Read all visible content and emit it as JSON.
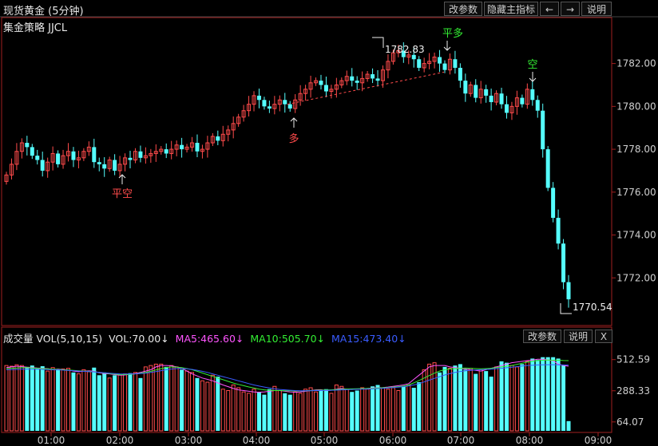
{
  "header": {
    "title": "现货黄金 (5分钟)",
    "strategy": "集金策略 JJCL",
    "buttons": {
      "params": "改参数",
      "hide_indicator": "隐藏主指标",
      "left": "←",
      "right": "→",
      "help": "说明"
    }
  },
  "volume_panel": {
    "label": "成交量 VOL(5,10,15)",
    "vol": "VOL:70.00↓",
    "ma5": "MA5:465.60↓",
    "ma10": "MA10:505.70↓",
    "ma15": "MA15:473.40↓",
    "buttons": {
      "params": "改参数",
      "help": "说明",
      "close": "X"
    }
  },
  "annotations": {
    "flat_short": "平空",
    "long": "多",
    "flat_long": "平多",
    "short": "空",
    "high_value": "1782.83",
    "low_value": "1770.54"
  },
  "colors": {
    "up": "#ff4b4b",
    "down": "#55ffff",
    "ma5": "#ff55ff",
    "ma10": "#33ee33",
    "ma15": "#3a5cff",
    "axis": "#a02020"
  },
  "chart_data": [
    {
      "type": "candlestick",
      "title": "现货黄金 (5分钟)",
      "y_ticks": [
        1782.0,
        1780.0,
        1778.0,
        1776.0,
        1774.0,
        1772.0
      ],
      "ylim": [
        1770.0,
        1783.4
      ],
      "x_ticks": [
        "01:00",
        "02:00",
        "03:00",
        "04:00",
        "05:00",
        "06:00",
        "07:00",
        "08:00",
        "09:00"
      ],
      "close_series": [
        1776.8,
        1777.3,
        1777.9,
        1778.3,
        1778.1,
        1777.7,
        1777.5,
        1777.0,
        1777.4,
        1777.8,
        1777.3,
        1777.7,
        1777.9,
        1777.5,
        1777.6,
        1777.9,
        1778.1,
        1777.4,
        1777.3,
        1777.1,
        1777.5,
        1777.0,
        1777.3,
        1777.6,
        1777.5,
        1777.9,
        1777.6,
        1777.7,
        1777.8,
        1777.9,
        1778.0,
        1777.8,
        1778.0,
        1778.2,
        1778.0,
        1778.1,
        1778.3,
        1777.9,
        1778.0,
        1778.3,
        1778.6,
        1778.4,
        1778.7,
        1778.9,
        1779.2,
        1779.5,
        1779.8,
        1780.1,
        1780.5,
        1780.3,
        1780.0,
        1779.9,
        1780.1,
        1780.3,
        1780.1,
        1779.9,
        1780.3,
        1780.6,
        1780.8,
        1781.1,
        1781.2,
        1781.0,
        1780.7,
        1780.8,
        1781.0,
        1781.2,
        1781.4,
        1781.2,
        1781.1,
        1781.3,
        1781.5,
        1781.3,
        1781.2,
        1781.7,
        1782.1,
        1782.5,
        1782.6,
        1782.3,
        1782.4,
        1782.2,
        1781.8,
        1782.0,
        1782.1,
        1782.3,
        1782.0,
        1781.7,
        1782.2,
        1781.8,
        1781.2,
        1780.6,
        1781.0,
        1780.4,
        1780.8,
        1780.5,
        1780.2,
        1780.6,
        1780.1,
        1779.7,
        1780.0,
        1780.4,
        1780.1,
        1780.8,
        1780.3,
        1779.8,
        1778.0,
        1776.2,
        1774.8,
        1773.6,
        1771.8,
        1771.0
      ],
      "annotations": [
        {
          "label": "平空",
          "x": "02:00",
          "y": 1776.8
        },
        {
          "label": "多",
          "x": "05:30",
          "y": 1779.4
        },
        {
          "label": "平多",
          "x": "08:00",
          "y": 1782.1
        },
        {
          "label": "空",
          "x": "09:00",
          "y": 1780.9
        },
        {
          "label": "1782.83",
          "x": "06:55",
          "y": 1782.83
        },
        {
          "label": "1770.54",
          "x": "09:35",
          "y": 1770.54
        }
      ]
    },
    {
      "type": "bar",
      "title": "成交量 VOL(5,10,15)",
      "y_ticks": [
        512.59,
        288.33,
        64.07
      ],
      "ylim": [
        0,
        620
      ],
      "series": [
        {
          "name": "VOL",
          "values": [
            470,
            465,
            475,
            470,
            460,
            470,
            450,
            465,
            430,
            455,
            440,
            445,
            450,
            420,
            410,
            440,
            425,
            455,
            400,
            420,
            380,
            400,
            405,
            410,
            415,
            420,
            380,
            460,
            470,
            480,
            480,
            460,
            470,
            460,
            440,
            430,
            420,
            380,
            360,
            350,
            400,
            390,
            300,
            290,
            330,
            310,
            280,
            270,
            300,
            280,
            260,
            300,
            320,
            290,
            270,
            260,
            280,
            270,
            300,
            310,
            280,
            290,
            300,
            270,
            330,
            320,
            300,
            280,
            290,
            310,
            300,
            320,
            330,
            310,
            300,
            310,
            290,
            320,
            330,
            310,
            350,
            440,
            480,
            490,
            420,
            460,
            450,
            470,
            480,
            440,
            450,
            410,
            440,
            430,
            390,
            460,
            500,
            490,
            470,
            460,
            480,
            500,
            520,
            510,
            530,
            530,
            530,
            520,
            470,
            70
          ]
        },
        {
          "name": "MA5",
          "values": [
            455,
            460,
            465,
            462,
            458,
            455,
            452,
            450,
            448,
            440,
            445,
            440,
            438,
            430,
            425,
            430,
            432,
            428,
            418,
            412,
            410,
            405,
            400,
            402,
            408,
            412,
            420,
            430,
            440,
            460,
            470,
            470,
            468,
            460,
            450,
            430,
            410,
            395,
            380,
            370,
            360,
            345,
            330,
            318,
            305,
            295,
            290,
            285,
            280,
            278,
            280,
            285,
            290,
            290,
            285,
            280,
            278,
            280,
            285,
            290,
            295,
            296,
            290,
            292,
            300,
            305,
            300,
            298,
            300,
            302,
            305,
            308,
            310,
            312,
            315,
            320,
            325,
            330,
            340,
            370,
            400,
            430,
            460,
            470,
            470,
            470,
            460,
            455,
            450,
            445,
            440,
            435,
            430,
            440,
            450,
            460,
            470,
            480,
            490,
            495,
            500,
            505,
            510,
            515,
            515,
            510,
            505,
            480,
            470,
            465
          ]
        },
        {
          "name": "MA10",
          "values": [
            448,
            450,
            452,
            455,
            455,
            452,
            450,
            448,
            446,
            444,
            442,
            440,
            438,
            435,
            432,
            430,
            428,
            425,
            420,
            416,
            412,
            408,
            405,
            405,
            406,
            410,
            415,
            420,
            428,
            438,
            448,
            455,
            460,
            458,
            455,
            448,
            440,
            428,
            416,
            404,
            392,
            380,
            368,
            356,
            344,
            334,
            325,
            316,
            308,
            300,
            295,
            292,
            290,
            290,
            289,
            288,
            287,
            287,
            288,
            290,
            292,
            293,
            294,
            295,
            297,
            299,
            301,
            302,
            303,
            304,
            305,
            306,
            308,
            310,
            312,
            315,
            318,
            322,
            330,
            345,
            362,
            380,
            398,
            415,
            430,
            440,
            445,
            448,
            450,
            452,
            450,
            448,
            446,
            448,
            450,
            455,
            460,
            465,
            470,
            478,
            486,
            494,
            500,
            505,
            508,
            510,
            508,
            508,
            506,
            505
          ]
        },
        {
          "name": "MA15",
          "values": [
            440,
            441,
            442,
            443,
            444,
            444,
            443,
            442,
            441,
            440,
            439,
            437,
            435,
            433,
            430,
            428,
            426,
            424,
            421,
            418,
            415,
            412,
            410,
            409,
            409,
            410,
            412,
            415,
            420,
            426,
            433,
            440,
            445,
            448,
            448,
            446,
            442,
            436,
            428,
            420,
            410,
            400,
            390,
            380,
            370,
            360,
            350,
            340,
            330,
            322,
            315,
            308,
            302,
            298,
            295,
            292,
            290,
            289,
            289,
            289,
            290,
            290,
            291,
            292,
            293,
            295,
            296,
            298,
            299,
            300,
            301,
            302,
            304,
            306,
            308,
            311,
            314,
            318,
            323,
            330,
            340,
            352,
            365,
            378,
            390,
            402,
            412,
            420,
            427,
            432,
            436,
            438,
            440,
            442,
            444,
            447,
            450,
            454,
            458,
            462,
            466,
            470,
            472,
            474,
            475,
            476,
            476,
            475,
            474,
            473
          ]
        }
      ],
      "x_ticks": [
        "01:00",
        "02:00",
        "03:00",
        "04:00",
        "05:00",
        "06:00",
        "07:00",
        "08:00",
        "09:00"
      ]
    }
  ]
}
